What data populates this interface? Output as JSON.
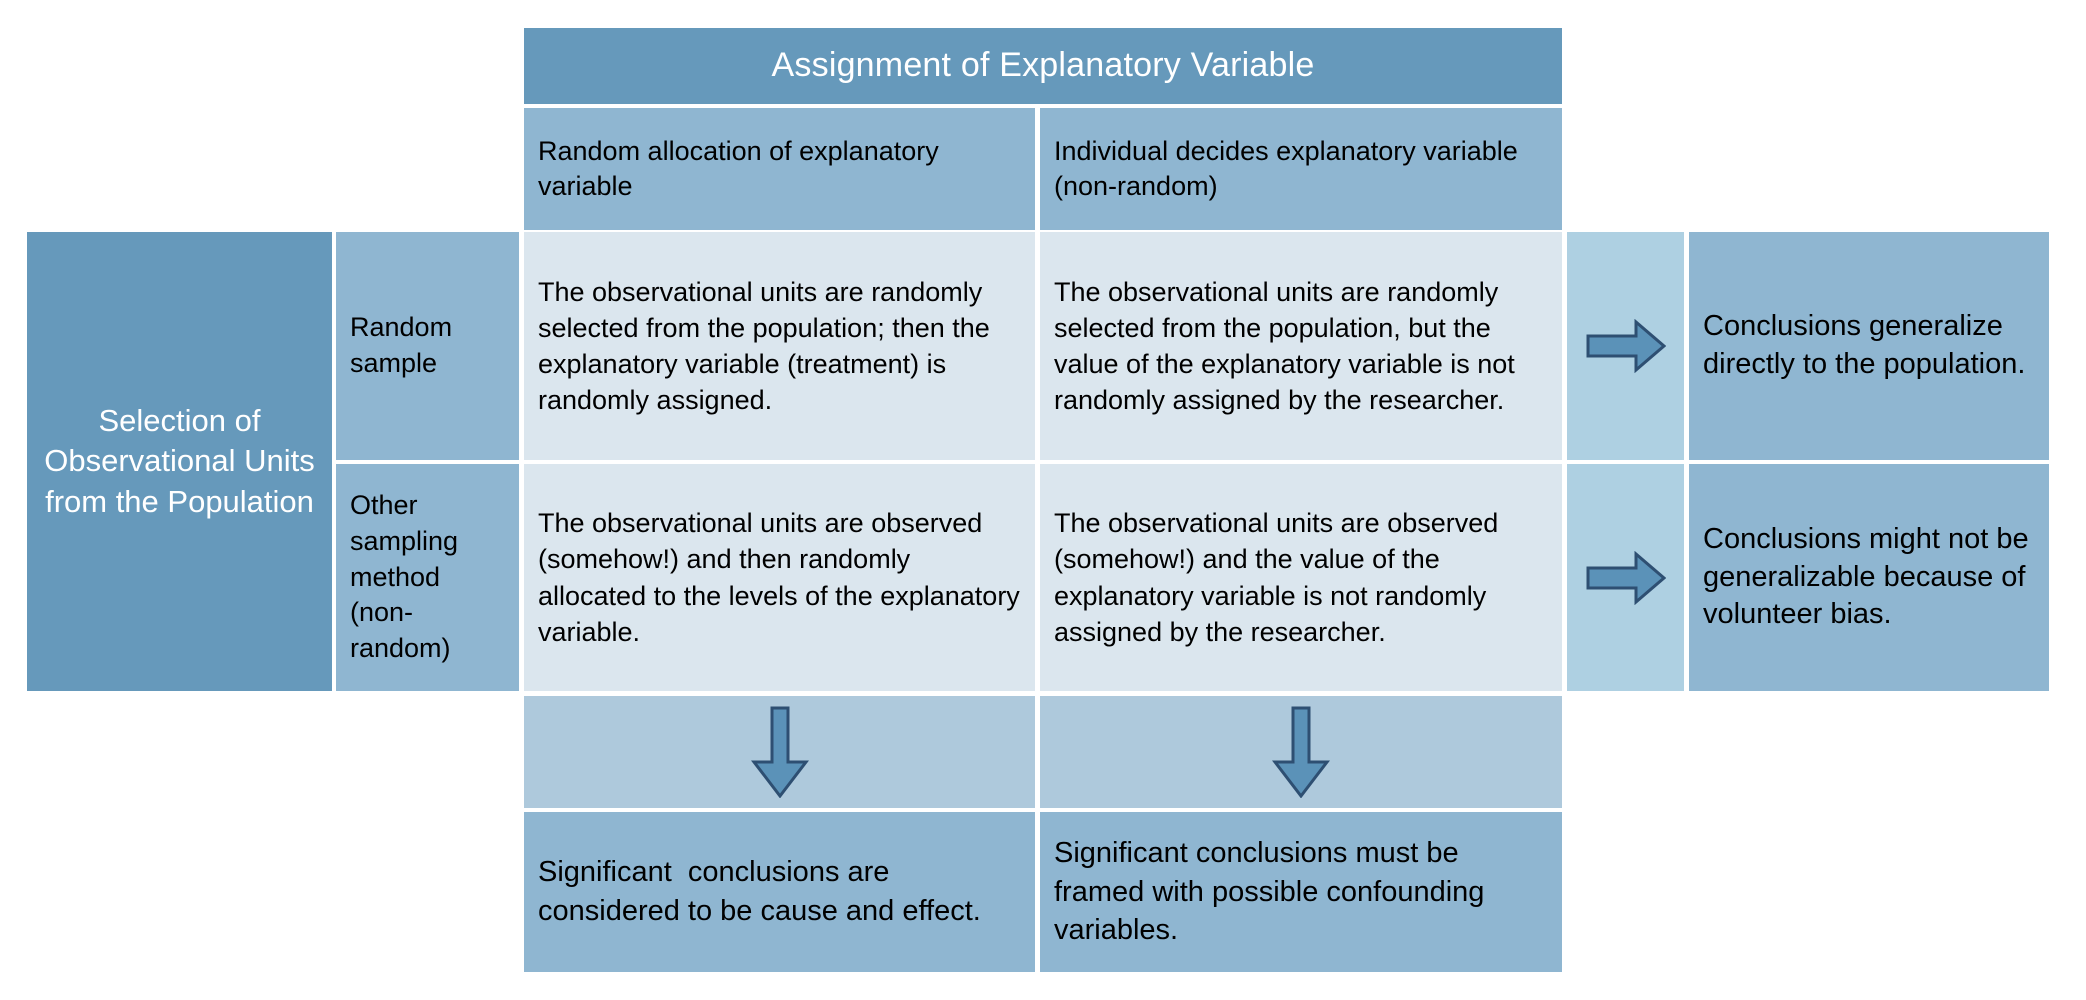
{
  "banner": {
    "title": "Assignment of Explanatory Variable"
  },
  "column_headers": [
    "Random allocation of explanatory variable",
    "Individual decides explanatory variable (non-random)"
  ],
  "row_title": "Selection of Observational Units from the Population",
  "row_labels": [
    "Random sample",
    "Other sampling method (non-random)"
  ],
  "body_cells": [
    [
      "The observational units are randomly selected from the population; then the explanatory variable (treatment) is randomly assigned.",
      "The observational units are randomly selected from the population, but the value of the explanatory variable is not randomly assigned by the researcher."
    ],
    [
      "The observational units are observed (somehow!) and then randomly allocated to the levels of the explanatory variable.",
      "The observational units are observed (somehow!) and the value of the explanatory variable is not randomly assigned by the researcher."
    ]
  ],
  "row_conclusions": [
    "Conclusions generalize directly to the population.",
    "Conclusions might not be generalizable because of volunteer bias."
  ],
  "column_conclusions": [
    "Significant  conclusions are considered to be cause and effect.",
    "Significant conclusions must be framed with possible confounding variables."
  ],
  "icons": {
    "right_arrow": "right-arrow-icon",
    "down_arrow": "down-arrow-icon"
  },
  "colors": {
    "banner_fill": "#6699bb",
    "header_fill": "#8fb6d1",
    "body_fill": "#dbe6ee",
    "gutter_fill": "#aed0e2",
    "arrow_fill": "#5b92b8",
    "arrow_stroke": "#2e4f72",
    "banner_text": "#ffffff",
    "body_text": "#000000"
  }
}
